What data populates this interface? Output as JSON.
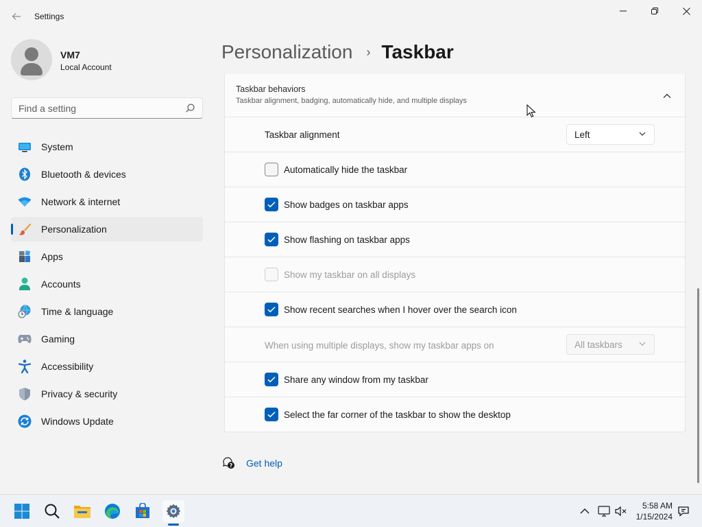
{
  "window": {
    "title": "Settings"
  },
  "user": {
    "name": "VM7",
    "account_type": "Local Account"
  },
  "search": {
    "placeholder": "Find a setting"
  },
  "sidebar": {
    "items": [
      {
        "label": "System",
        "icon": "monitor-icon"
      },
      {
        "label": "Bluetooth & devices",
        "icon": "bluetooth-icon"
      },
      {
        "label": "Network & internet",
        "icon": "wifi-icon"
      },
      {
        "label": "Personalization",
        "icon": "paintbrush-icon",
        "active": true
      },
      {
        "label": "Apps",
        "icon": "apps-icon"
      },
      {
        "label": "Accounts",
        "icon": "person-icon"
      },
      {
        "label": "Time & language",
        "icon": "globe-clock-icon"
      },
      {
        "label": "Gaming",
        "icon": "gamepad-icon"
      },
      {
        "label": "Accessibility",
        "icon": "accessibility-icon"
      },
      {
        "label": "Privacy & security",
        "icon": "shield-icon"
      },
      {
        "label": "Windows Update",
        "icon": "update-icon"
      }
    ]
  },
  "breadcrumb": {
    "parent": "Personalization",
    "separator": "›",
    "current": "Taskbar"
  },
  "section": {
    "title": "Taskbar behaviors",
    "description": "Taskbar alignment, badging, automatically hide, and multiple displays"
  },
  "settings": {
    "alignment": {
      "label": "Taskbar alignment",
      "value": "Left"
    },
    "auto_hide": {
      "label": "Automatically hide the taskbar",
      "checked": false
    },
    "badges": {
      "label": "Show badges on taskbar apps",
      "checked": true
    },
    "flashing": {
      "label": "Show flashing on taskbar apps",
      "checked": true
    },
    "all_displays": {
      "label": "Show my taskbar on all displays",
      "checked": false,
      "disabled": true
    },
    "recent_searches": {
      "label": "Show recent searches when I hover over the search icon",
      "checked": true
    },
    "multi_display_apps": {
      "label": "When using multiple displays, show my taskbar apps on",
      "value": "All taskbars",
      "disabled": true
    },
    "share_window": {
      "label": "Share any window from my taskbar",
      "checked": true
    },
    "far_corner": {
      "label": "Select the far corner of the taskbar to show the desktop",
      "checked": true
    }
  },
  "help": {
    "label": "Get help"
  },
  "taskbar": {
    "apps": [
      "start-icon",
      "search-icon",
      "file-explorer-icon",
      "edge-icon",
      "store-icon",
      "settings-icon"
    ],
    "clock": {
      "time": "5:58 AM",
      "date": "1/15/2024"
    }
  },
  "colors": {
    "accent": "#005fb8",
    "background": "#f3f3f3",
    "card": "#fbfbfb"
  }
}
